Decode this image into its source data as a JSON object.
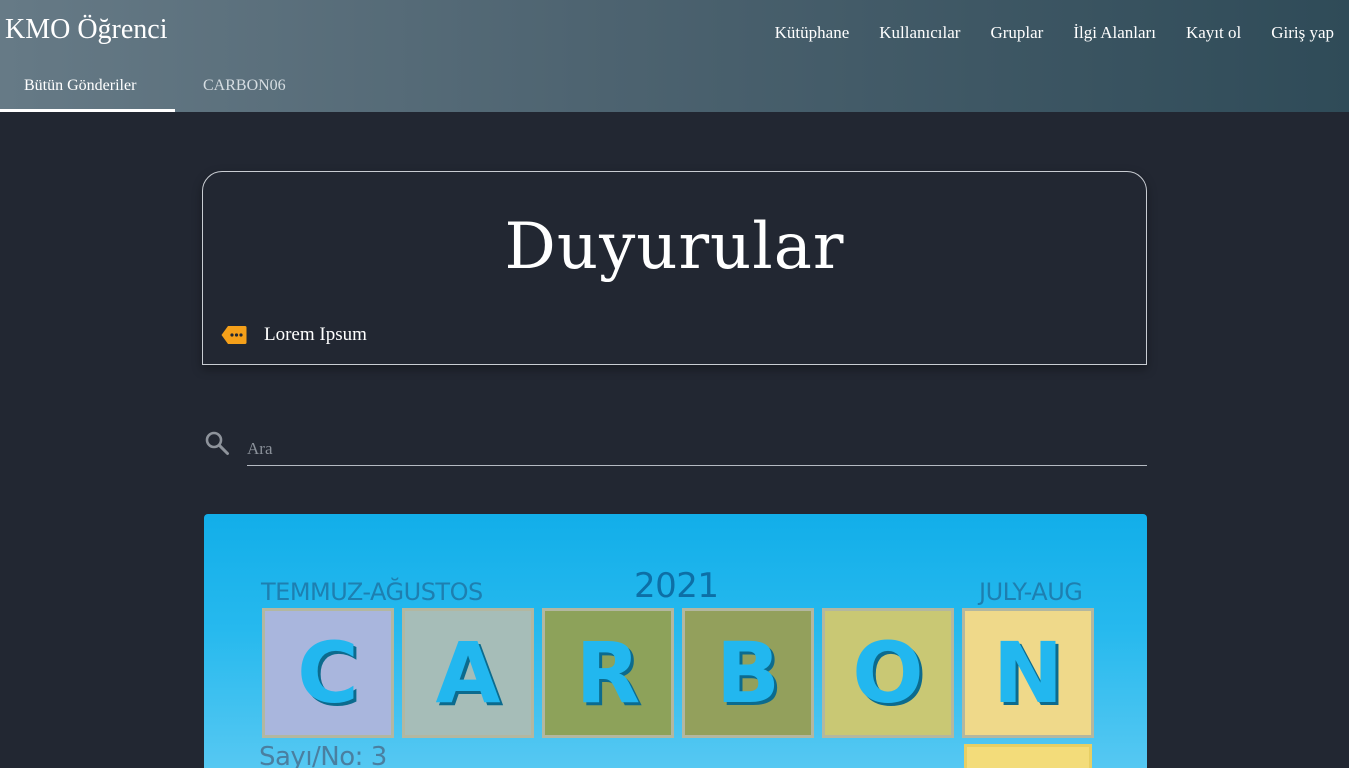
{
  "brand": "KMO Öğrenci",
  "nav": [
    "Kütüphane",
    "Kullanıcılar",
    "Gruplar",
    "İlgi Alanları",
    "Kayıt ol",
    "Giriş yap"
  ],
  "tabs": [
    {
      "label": "Bütün Gönderiler",
      "active": true
    },
    {
      "label": "CARBON06",
      "active": false
    }
  ],
  "card": {
    "title": "Duyurular",
    "tag_icon": "tag-icon",
    "tag_label": "Lorem Ipsum"
  },
  "search": {
    "icon": "search-icon",
    "placeholder": "Ara",
    "value": ""
  },
  "cover": {
    "top_left": "TEMMUZ-AĞUSTOS",
    "year": "2021",
    "top_right": "JULY-AUG",
    "tiles": [
      {
        "letter": "C",
        "color": "#a9b6dd"
      },
      {
        "letter": "A",
        "color": "#a6bdb8"
      },
      {
        "letter": "R",
        "color": "#8da25a"
      },
      {
        "letter": "B",
        "color": "#93a05c"
      },
      {
        "letter": "O",
        "color": "#c9c874"
      },
      {
        "letter": "N",
        "color": "#efd98a"
      }
    ],
    "issue": "Sayı/No: 3"
  },
  "colors": {
    "background": "#222732",
    "header_left": "#667a86",
    "header_right": "#2f4b58",
    "tag_orange": "#f5a01a",
    "cover_blue": "#26b9ee"
  }
}
